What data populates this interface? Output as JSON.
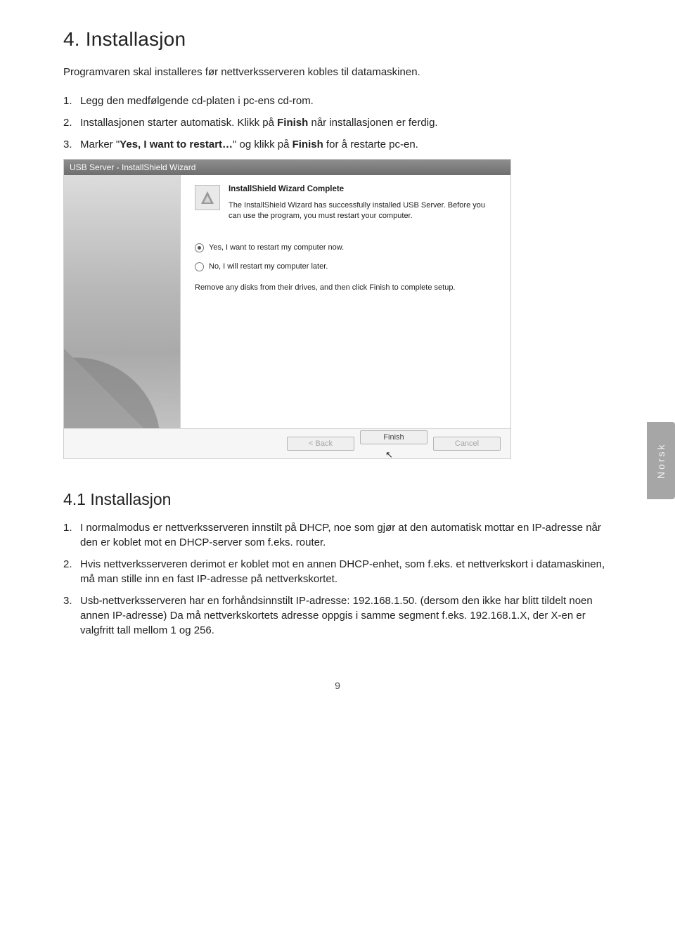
{
  "page": {
    "number": "9"
  },
  "sideTab": {
    "label": "Norsk"
  },
  "head": {
    "title": "4. Installasjon",
    "intro": "Programvaren skal installeres før nettverksserveren kobles til datamaskinen.",
    "items": [
      {
        "plain": "Legg den medfølgende cd-platen i pc-ens cd-rom."
      },
      {
        "pre": "Installasjonen starter automatisk. Klikk på ",
        "b1": "Finish",
        "post1": " når installasjonen er ferdig."
      },
      {
        "pre": "Marker \"",
        "b1": "Yes, I want to restart…",
        "mid": "\" og klikk på ",
        "b2": "Finish",
        "post2": " for å restarte pc-en."
      }
    ]
  },
  "wizard": {
    "title": "USB Server - InstallShield Wizard",
    "heading": "InstallShield Wizard Complete",
    "para1": "The InstallShield Wizard has successfully installed USB Server. Before you can use the program, you must restart your computer.",
    "radio1": "Yes, I want to restart my computer now.",
    "radio2": "No, I will restart my computer later.",
    "para2": "Remove any disks from their drives, and then click Finish to complete setup.",
    "btnBack": "< Back",
    "btnFinish": "Finish",
    "btnCancel": "Cancel"
  },
  "sub": {
    "title": "4.1 Installasjon",
    "items": [
      "I normalmodus er nettverksserveren innstilt på DHCP, noe som gjør at den automatisk mottar en IP-adresse når den er koblet mot en DHCP-server som f.eks. router.",
      "Hvis nettverksserveren derimot er koblet mot en annen DHCP-enhet, som f.eks. et nettverkskort i datamaskinen, må man stille inn en fast IP-adresse på nettverkskortet.",
      "Usb-nettverksserveren har en forhåndsinnstilt IP-adresse: 192.168.1.50. (dersom den ikke har blitt tildelt noen annen IP-adresse) Da må nettverkskortets adresse oppgis i samme segment f.eks. 192.168.1.X, der X-en er valgfritt tall mellom 1 og 256."
    ]
  }
}
